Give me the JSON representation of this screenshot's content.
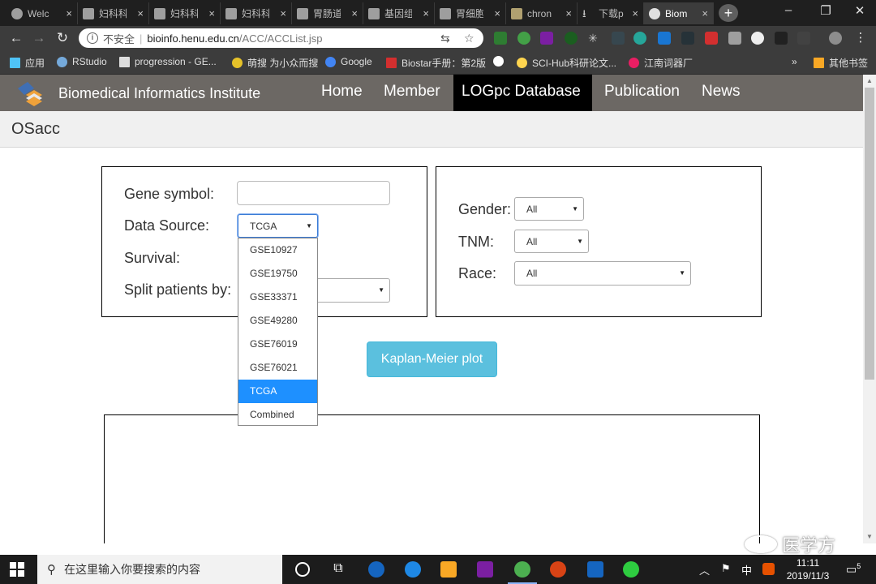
{
  "browser": {
    "tabs": [
      {
        "label": "Welc",
        "icon": "chrome-globe-icon"
      },
      {
        "label": "妇科科",
        "icon": "page-icon"
      },
      {
        "label": "妇科科",
        "icon": "page-icon"
      },
      {
        "label": "妇科科",
        "icon": "page-icon"
      },
      {
        "label": "胃肠道",
        "icon": "page-icon"
      },
      {
        "label": "基因组",
        "icon": "page-icon"
      },
      {
        "label": "胃细胞",
        "icon": "page-icon"
      },
      {
        "label": "chron",
        "icon": "image-icon"
      },
      {
        "label": "下载p",
        "icon": "download-icon"
      },
      {
        "label": "Biom",
        "icon": "chrome-globe-icon",
        "active": true
      }
    ],
    "close_glyph": "×",
    "new_tab_glyph": "+",
    "address": {
      "security_label": "不安全",
      "separator": "|",
      "host": "bioinfo.henu.edu.cn",
      "path": "/ACC/ACCList.jsp"
    },
    "bookmarks": [
      {
        "label": "应用",
        "icon": "apps-grid-icon",
        "color": "#e0e0e0"
      },
      {
        "label": "RStudio",
        "icon": "rstudio-icon",
        "color": "#75aadb"
      },
      {
        "label": "progression - GE...",
        "icon": "page-icon",
        "color": "#dddddd"
      },
      {
        "label": "萌搜 为小众而搜",
        "icon": "mengsou-icon",
        "color": "#e6c229"
      },
      {
        "label": "Google",
        "icon": "google-icon",
        "color": "#4285f4"
      },
      {
        "label": "Biostar手册：第2版",
        "icon": "biostar-icon",
        "color": "#d32f2f"
      },
      {
        "label": "",
        "icon": "github-icon",
        "color": "#ffffff"
      },
      {
        "label": "SCI-Hub科研论文...",
        "icon": "scihub-icon",
        "color": "#ffd54f"
      },
      {
        "label": "江南词器厂",
        "icon": "jiangnan-icon",
        "color": "#e91e63"
      }
    ],
    "bookmarks_more": "»",
    "other_bookmarks": "其他书签"
  },
  "site": {
    "brand": "Biomedical Informatics Institute",
    "nav": [
      {
        "label": "Home",
        "active": false
      },
      {
        "label": "Member",
        "active": false
      },
      {
        "label": "LOGpc Database",
        "active": true
      },
      {
        "label": "Publication",
        "active": false
      },
      {
        "label": "News",
        "active": false
      }
    ],
    "page_title": "OSacc"
  },
  "form": {
    "gene_symbol": {
      "label": "Gene symbol:",
      "value": ""
    },
    "data_source": {
      "label": "Data Source:",
      "value": "TCGA",
      "options": [
        "GSE10927",
        "GSE19750",
        "GSE33371",
        "GSE49280",
        "GSE76019",
        "GSE76021",
        "TCGA",
        "Combined"
      ],
      "selected_index": 6,
      "open": true
    },
    "survival": {
      "label": "Survival:"
    },
    "split": {
      "label": "Split patients by:",
      "value": ""
    },
    "gender": {
      "label": "Gender:",
      "value": "All"
    },
    "tnm": {
      "label": "TNM:",
      "value": "All"
    },
    "race": {
      "label": "Race:",
      "value": "All"
    },
    "submit_label": "Kaplan-Meier plot"
  },
  "watermark": "医学方",
  "taskbar": {
    "search_placeholder": "在这里输入你要搜索的内容",
    "ime_label": "中",
    "time": "11:11",
    "date": "2019/11/3",
    "notification_count": "5",
    "colors": {
      "chrome": "#4caf50",
      "edge": "#1e88e5",
      "onenote": "#7b1fa2",
      "powerpoint": "#d84315",
      "word": "#1565c0",
      "wechat": "#2ecc40"
    }
  }
}
